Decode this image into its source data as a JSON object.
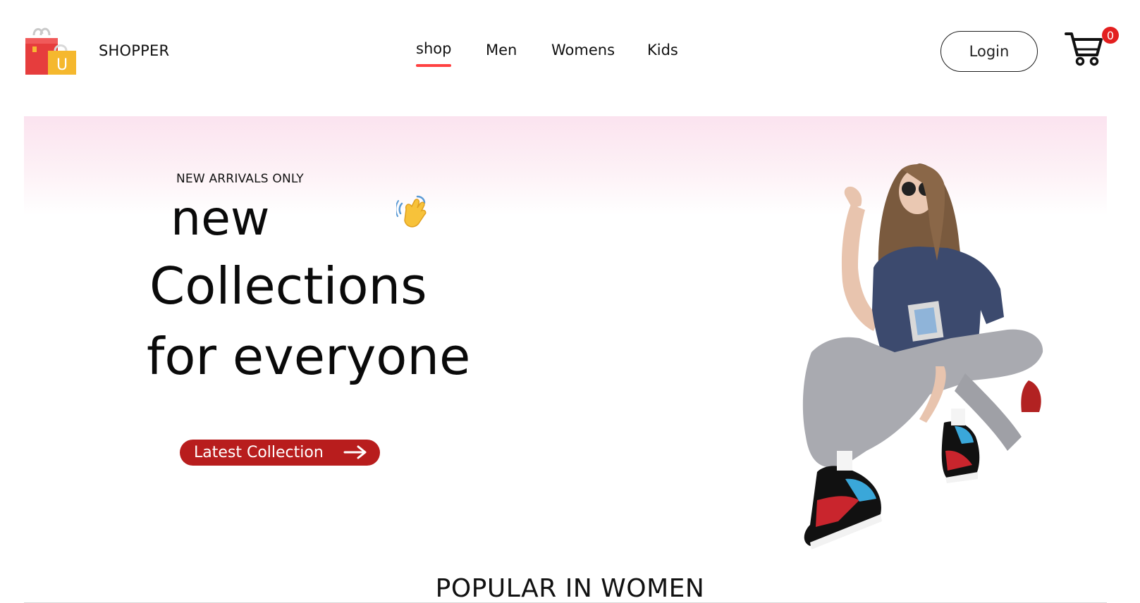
{
  "brand": {
    "name": "SHOPPER",
    "logo_icon": "shopping-bags-icon",
    "logo_letter": "U"
  },
  "nav": {
    "active": "shop",
    "items": [
      {
        "label": "shop"
      },
      {
        "label": "Men"
      },
      {
        "label": "Womens"
      },
      {
        "label": "Kids"
      }
    ]
  },
  "header": {
    "login_label": "Login",
    "cart_icon": "cart-icon",
    "cart_count": "0"
  },
  "hero": {
    "eyebrow": "NEW ARRIVALS ONLY",
    "headline_1": "new",
    "headline_2": "Collections",
    "headline_3": "for everyone",
    "wave_icon": "waving-hand-icon",
    "cta_label": "Latest Collection",
    "cta_icon": "arrow-right-icon",
    "image": "hero-model-image"
  },
  "section": {
    "title": "POPULAR IN WOMEN"
  },
  "colors": {
    "accent": "#b81d1d",
    "nav_underline": "#ff4141",
    "badge": "#e31f1f",
    "hero_gradient_top": "#fbe3ef"
  }
}
